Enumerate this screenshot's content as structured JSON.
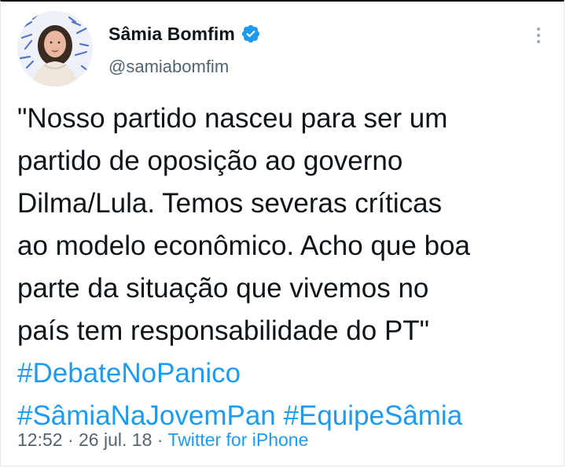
{
  "author": {
    "display_name": "Sâmia Bomfim",
    "handle": "@samiabomfim",
    "verified": true,
    "verified_icon": "verified-badge-icon",
    "avatar_icon": "profile-photo"
  },
  "menu": {
    "more_icon": "more-vertical-icon"
  },
  "tweet": {
    "lines": [
      "\"Nosso partido nasceu para ser um",
      "partido de oposição ao governo",
      "Dilma/Lula. Temos severas críticas",
      "ao modelo econômico. Acho que boa",
      "parte da situação que vivemos no",
      "país tem responsabilidade do PT\""
    ],
    "hashtags": [
      "#DebateNoPanico",
      "#SâmiaNaJovemPan",
      "#EquipeSâmia"
    ]
  },
  "meta": {
    "time": "12:52",
    "date": "26 jul. 18",
    "separator": "·",
    "source": "Twitter for iPhone"
  },
  "colors": {
    "link": "#1d9bf0",
    "text": "#0f1419",
    "secondary": "#536471"
  }
}
